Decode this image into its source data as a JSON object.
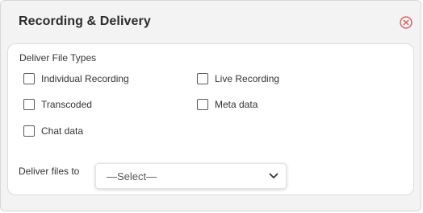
{
  "dialog": {
    "title": "Recording & Delivery",
    "close_icon": "close-circle-icon",
    "accent_color": "#d9534f"
  },
  "file_types": {
    "label": "Deliver File Types",
    "options": [
      {
        "label": "Individual Recording",
        "checked": false
      },
      {
        "label": "Live Recording",
        "checked": false
      },
      {
        "label": "Transcoded",
        "checked": false
      },
      {
        "label": "Meta data",
        "checked": false
      },
      {
        "label": "Chat data",
        "checked": false
      }
    ]
  },
  "delivery": {
    "label": "Deliver files to",
    "selected": "—Select—",
    "dropdown_icon": "chevron-down-icon"
  }
}
